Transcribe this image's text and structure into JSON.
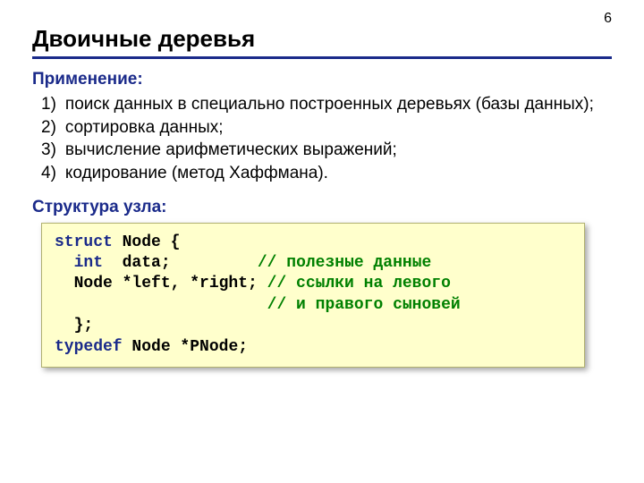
{
  "page_number": "6",
  "title": "Двоичные деревья",
  "sections": {
    "application_label": "Применение:",
    "structure_label": "Структура узла:"
  },
  "applications": [
    {
      "num": "1)",
      "text": "поиск данных в специально построенных деревьях (базы данных);"
    },
    {
      "num": "2)",
      "text": "сортировка данных;"
    },
    {
      "num": "3)",
      "text": "вычисление арифметических выражений;"
    },
    {
      "num": "4)",
      "text": "кодирование (метод Хаффмана)."
    }
  ],
  "code": {
    "l1_kw": "struct",
    "l1_rest": " Node {",
    "l2_kw": "int",
    "l2_rest": "  data;",
    "l2_cm": "// полезные данные",
    "l3_txt": "  Node *left, *right; ",
    "l3_cm": "// ссылки на левого",
    "l4_cm": "// и правого сыновей",
    "l5_txt": "  };",
    "l6_kw": "typedef",
    "l6_rest": " Node *PNode;"
  }
}
